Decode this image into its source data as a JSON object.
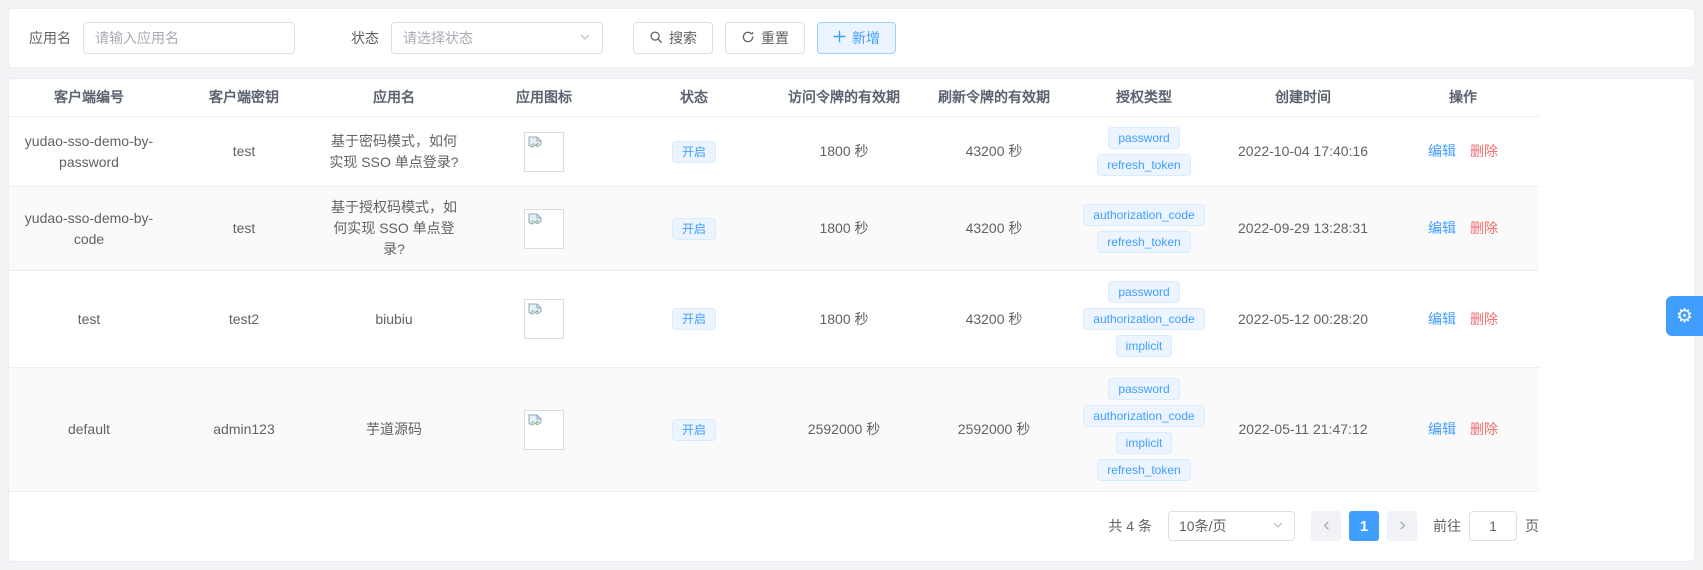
{
  "colors": {
    "primary": "#409eff",
    "danger": "#f56c6c",
    "tag_bg": "#ecf5ff",
    "page_bg": "#f2f3f5"
  },
  "icons": {
    "search": "magnifier",
    "reset": "circular-refresh-arrow",
    "add": "plus",
    "select_arrow": "chevron-down",
    "pager_prev": "chevron-left",
    "pager_next": "chevron-right",
    "settings": "gear",
    "app_icon": "broken-image-placeholder",
    "gear_glyph": "⚙"
  },
  "search_bar": {
    "app_name_label": "应用名",
    "app_name_placeholder": "请输入应用名",
    "status_label": "状态",
    "status_placeholder": "请选择状态",
    "search_button": "搜索",
    "reset_button": "重置",
    "add_button": "新增"
  },
  "table": {
    "columns": [
      "客户端编号",
      "客户端密钥",
      "应用名",
      "应用图标",
      "状态",
      "访问令牌的有效期",
      "刷新令牌的有效期",
      "授权类型",
      "创建时间",
      "操作"
    ],
    "actions": {
      "edit": "编辑",
      "delete": "删除"
    },
    "rows": [
      {
        "client_id": "yudao-sso-demo-by-password",
        "secret": "test",
        "name": "基于密码模式，如何实现 SSO 单点登录?",
        "status": "开启",
        "access_token_validity": "1800 秒",
        "refresh_token_validity": "43200 秒",
        "grant_types": [
          "password",
          "refresh_token"
        ],
        "create_time": "2022-10-04 17:40:16"
      },
      {
        "client_id": "yudao-sso-demo-by-code",
        "secret": "test",
        "name": "基于授权码模式，如何实现 SSO 单点登录?",
        "status": "开启",
        "access_token_validity": "1800 秒",
        "refresh_token_validity": "43200 秒",
        "grant_types": [
          "authorization_code",
          "refresh_token"
        ],
        "create_time": "2022-09-29 13:28:31"
      },
      {
        "client_id": "test",
        "secret": "test2",
        "name": "biubiu",
        "status": "开启",
        "access_token_validity": "1800 秒",
        "refresh_token_validity": "43200 秒",
        "grant_types": [
          "password",
          "authorization_code",
          "implicit"
        ],
        "create_time": "2022-05-12 00:28:20"
      },
      {
        "client_id": "default",
        "secret": "admin123",
        "name": "芋道源码",
        "status": "开启",
        "access_token_validity": "2592000 秒",
        "refresh_token_validity": "2592000 秒",
        "grant_types": [
          "password",
          "authorization_code",
          "implicit",
          "refresh_token"
        ],
        "create_time": "2022-05-11 21:47:12"
      }
    ]
  },
  "pagination": {
    "total_text": "共 4 条",
    "page_size_label": "10条/页",
    "current_page": "1",
    "goto_label": "前往",
    "goto_value": "1",
    "goto_suffix": "页"
  }
}
